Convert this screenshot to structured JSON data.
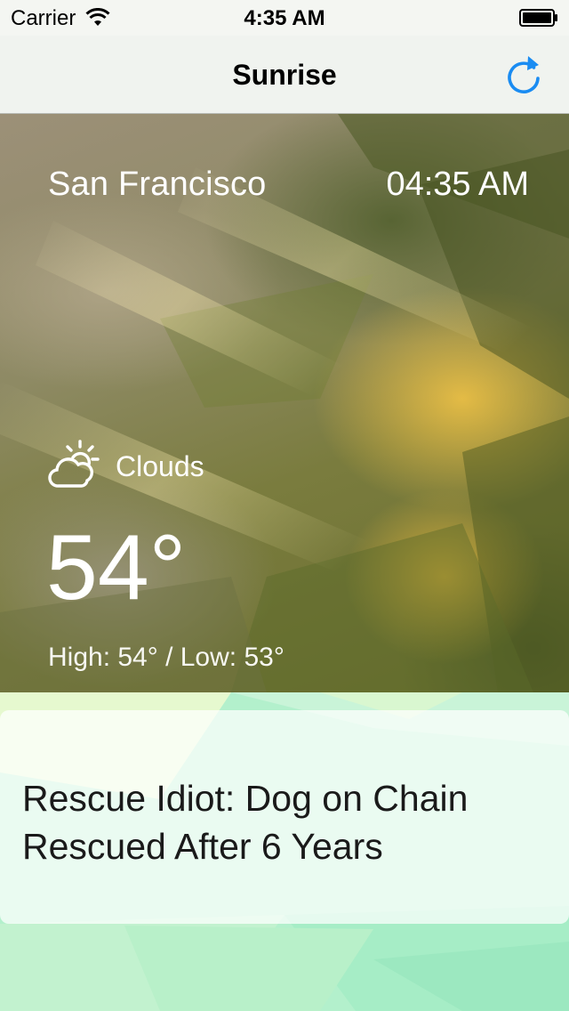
{
  "status_bar": {
    "carrier": "Carrier",
    "time": "4:35 AM"
  },
  "nav": {
    "title": "Sunrise",
    "refresh_icon": "refresh-icon",
    "accent_color": "#1a8cf2"
  },
  "weather": {
    "city": "San Francisco",
    "local_time": "04:35 AM",
    "condition": "Clouds",
    "condition_icon": "partly-cloudy-icon",
    "temperature": "54°",
    "high_low": "High: 54° / Low: 53°"
  },
  "news": {
    "headline": "Rescue Idiot:  Dog on Chain Rescued After 6 Years"
  }
}
